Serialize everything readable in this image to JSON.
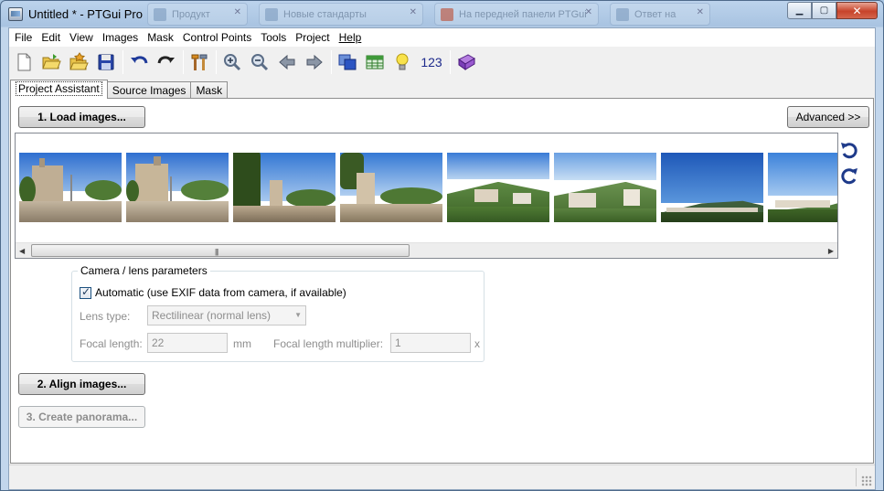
{
  "window": {
    "title": "Untitled * - PTGui Pro",
    "background_tabs": [
      "Продукт",
      "Новые стандарты",
      "На передней панели PTGui",
      "Ответ на"
    ],
    "controls": {
      "minimize": "▁",
      "maximize": "▢",
      "close": "✕"
    }
  },
  "menu": [
    "File",
    "Edit",
    "View",
    "Images",
    "Mask",
    "Control Points",
    "Tools",
    "Project",
    "Help"
  ],
  "toolbar": {
    "icons": [
      "new-file-icon",
      "open-folder-icon",
      "open-recent-icon",
      "save-icon",
      "undo-icon",
      "redo-icon",
      "tools-icon",
      "zoom-in-icon",
      "zoom-out-icon",
      "arrow-left-icon",
      "arrow-right-icon",
      "panorama-editor-icon",
      "table-icon",
      "bulb-icon",
      "numbers-icon",
      "help-book-icon"
    ],
    "numbers_label": "123"
  },
  "tabs": [
    {
      "label": "Project Assistant",
      "active": true
    },
    {
      "label": "Source Images",
      "active": false
    },
    {
      "label": "Mask",
      "active": false
    }
  ],
  "assistant": {
    "load_button": "1. Load images...",
    "advanced_button": "Advanced >>",
    "align_button": "2. Align images...",
    "create_button": "3. Create panorama...",
    "thumbnail_count": 8
  },
  "camera": {
    "group_title": "Camera / lens parameters",
    "automatic_label": "Automatic (use EXIF data from camera, if available)",
    "automatic_checked": true,
    "lens_type_label": "Lens type:",
    "lens_type_value": "Rectilinear (normal lens)",
    "focal_length_label": "Focal length:",
    "focal_length_value": "22",
    "focal_length_unit": "mm",
    "multiplier_label": "Focal length multiplier:",
    "multiplier_value": "1",
    "multiplier_unit": "x"
  },
  "colors": {
    "accent": "#1e3a8a",
    "window_frame": "#a8c3e1",
    "sky": "#3c78c4",
    "vegetation": "#3e6426"
  }
}
